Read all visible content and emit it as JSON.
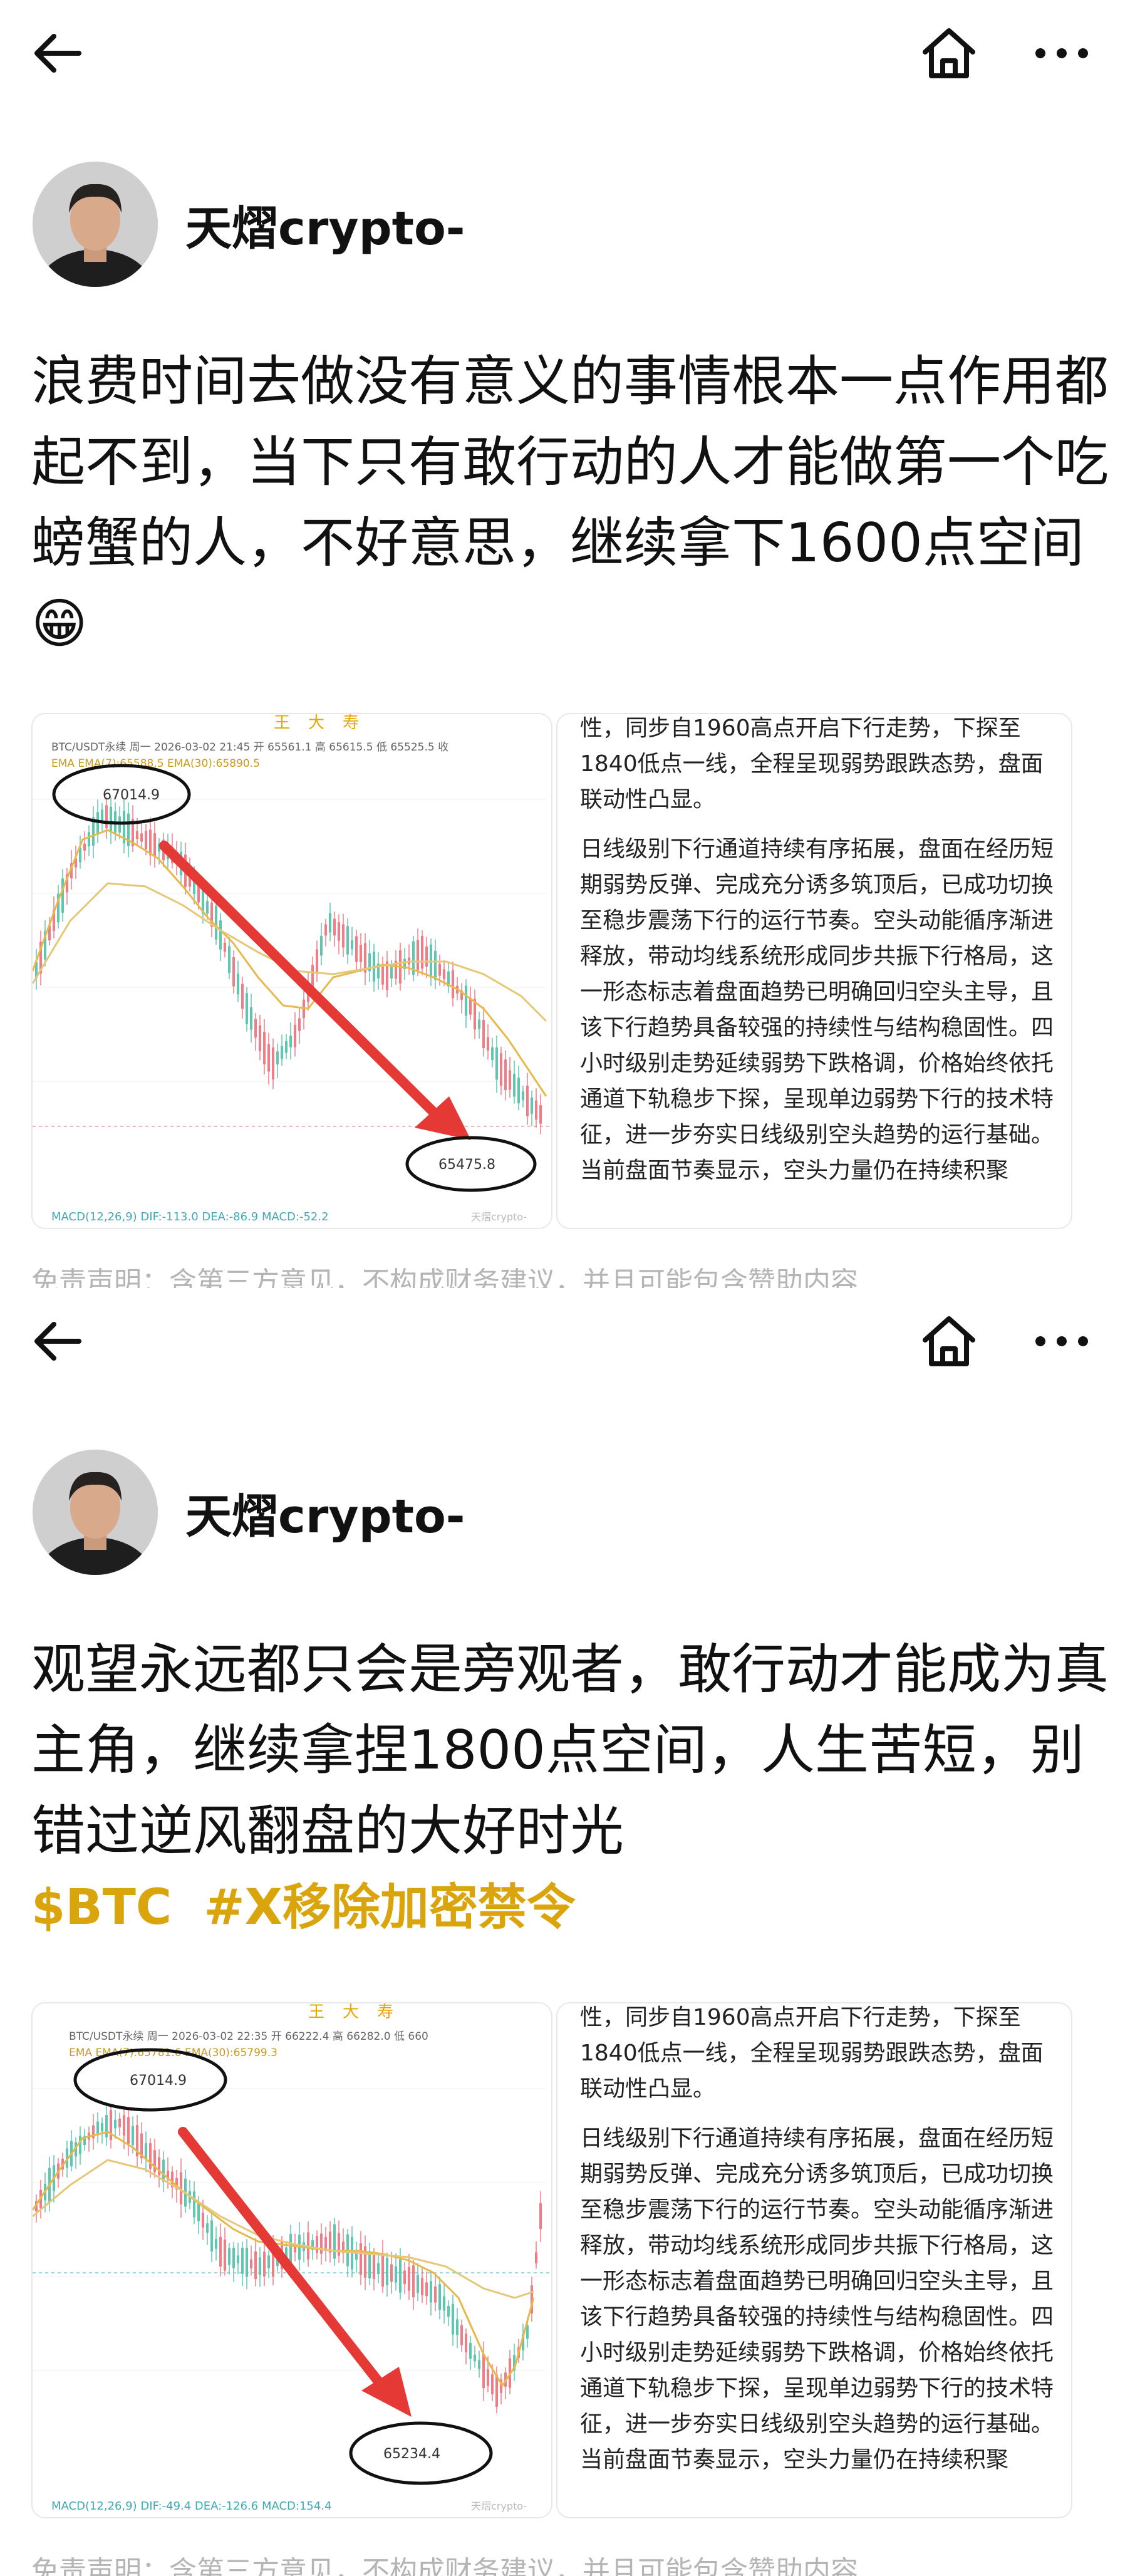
{
  "nav": {
    "back_icon": "arrow-left-icon",
    "home_icon": "home-icon",
    "more_icon": "more-dots-icon"
  },
  "colors": {
    "tag": "#d9a40c",
    "arrow": "#e53935",
    "candle_up": "#5fc7b0",
    "candle_down": "#f07c86",
    "ema7": "#e7b84a",
    "ema30": "#e5c777"
  },
  "posts": [
    {
      "author": "天熠crypto-",
      "text": "浪费时间去做没有意义的事情根本一点作用都起不到，当下只有敢行动的人才能做第一个吃螃蟹的人，不好意思，继续拿下1600点空间😁",
      "tags": [],
      "chart": {
        "top_labels": [
          "王",
          "大",
          "寿"
        ],
        "header": "BTC/USDT永续 周一 2026-03-02 21:45 开 65561.1 高 65615.5 低 65525.5 收",
        "ema_line": "EMA  EMA(7):65588.5  EMA(30):65890.5",
        "macd": "MACD(12,26,9)  DIF:-113.0  DEA:-86.9  MACD:-52.2",
        "high_label": "67014.9",
        "low_label": "65475.8",
        "watermark": "天熠crypto-"
      },
      "card_paragraphs": [
        "性，同步自1960高点开启下行走势，下探至1840低点一线，全程呈现弱势跟跌态势，盘面联动性凸显。",
        "日线级别下行通道持续有序拓展，盘面在经历短期弱势反弹、完成充分诱多筑顶后，已成功切换至稳步震荡下行的运行节奏。空头动能循序渐进释放，带动均线系统形成同步共振下行格局，这一形态标志着盘面趋势已明确回归空头主导，且该下行趋势具备较强的持续性与结构稳固性。四小时级别走势延续弱势下跌格调，价格始终依托通道下轨稳步下探，呈现单边弱势下行的技术特征，进一步夯实日线级别空头趋势的运行基础。当前盘面节奏显示，空头力量仍在持续积聚"
      ],
      "disclaimer": "免责声明：含第三方意见，不构成财务建议，并且可能包含赞助内容"
    },
    {
      "author": "天熠crypto-",
      "text": "观望永远都只会是旁观者，敢行动才能成为真主角，继续拿捏1800点空间，人生苦短，别错过逆风翻盘的大好时光",
      "tags": [
        "$BTC",
        "#X移除加密禁令"
      ],
      "chart": {
        "top_labels": [
          "王",
          "大",
          "寿"
        ],
        "header": "BTC/USDT永续 周一 2026-03-02 22:35 开 66222.4 高 66282.0 低 660",
        "ema_line": "EMA  EMA(7):65781.6  EMA(30):65799.3",
        "macd": "MACD(12,26,9)  DIF:-49.4  DEA:-126.6  MACD:154.4",
        "high_label": "67014.9",
        "low_label": "65234.4",
        "watermark": "天熠crypto-"
      },
      "card_paragraphs": [
        "性，同步自1960高点开启下行走势，下探至1840低点一线，全程呈现弱势跟跌态势，盘面联动性凸显。",
        "日线级别下行通道持续有序拓展，盘面在经历短期弱势反弹、完成充分诱多筑顶后，已成功切换至稳步震荡下行的运行节奏。空头动能循序渐进释放，带动均线系统形成同步共振下行格局，这一形态标志着盘面趋势已明确回归空头主导，且该下行趋势具备较强的持续性与结构稳固性。四小时级别走势延续弱势下跌格调，价格始终依托通道下轨稳步下探，呈现单边弱势下行的技术特征，进一步夯实日线级别空头趋势的运行基础。当前盘面节奏显示，空头力量仍在持续积聚"
      ],
      "disclaimer": "免责声明：含第三方意见，不构成财务建议，并且可能包含赞助内容"
    }
  ]
}
